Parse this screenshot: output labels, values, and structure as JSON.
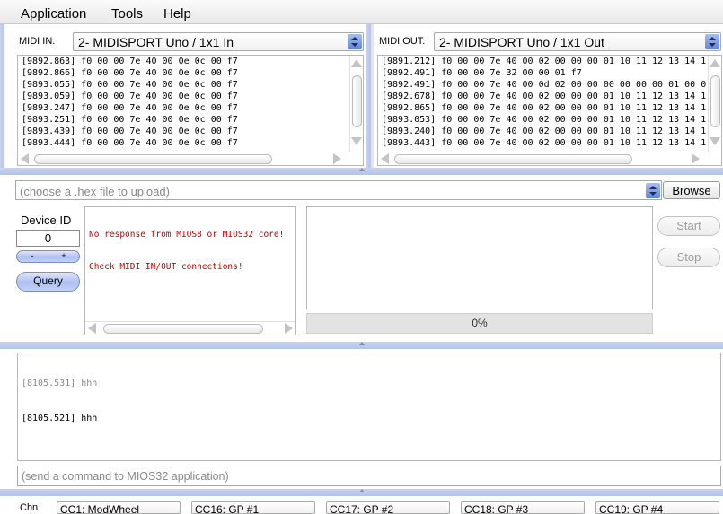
{
  "menubar": {
    "items": [
      "Application",
      "Tools",
      "Help"
    ]
  },
  "midi_in": {
    "label": "MIDI IN:",
    "selected": "2- MIDISPORT Uno / 1x1 In",
    "log": [
      "[9892.863] f0 00 00 7e 40 00 0e 0c 00 f7",
      "[9892.866] f0 00 00 7e 40 00 0e 0c 00 f7",
      "[9893.055] f0 00 00 7e 40 00 0e 0c 00 f7",
      "[9893.059] f0 00 00 7e 40 00 0e 0c 00 f7",
      "[9893.247] f0 00 00 7e 40 00 0e 0c 00 f7",
      "[9893.251] f0 00 00 7e 40 00 0e 0c 00 f7",
      "[9893.439] f0 00 00 7e 40 00 0e 0c 00 f7",
      "[9893.444] f0 00 00 7e 40 00 0e 0c 00 f7"
    ]
  },
  "midi_out": {
    "label": "MIDI OUT:",
    "selected": "2- MIDISPORT Uno / 1x1 Out",
    "log": [
      "[9891.212] f0 00 00 7e 40 00 02 00 00 00 01 10 11 12 13 14 1",
      "[9892.491] f0 00 00 7e 32 00 00 01 f7",
      "[9892.491] f0 00 00 7e 40 00 0d 02 00 00 00 00 00 00 01 00 0",
      "[9892.678] f0 00 00 7e 40 00 02 00 00 00 01 10 11 12 13 14 1",
      "[9892.865] f0 00 00 7e 40 00 02 00 00 00 01 10 11 12 13 14 1",
      "[9893.053] f0 00 00 7e 40 00 02 00 00 00 01 10 11 12 13 14 1",
      "[9893.240] f0 00 00 7e 40 00 02 00 00 00 01 10 11 12 13 14 1",
      "[9893.443] f0 00 00 7e 40 00 02 00 00 00 01 10 11 12 13 14 1"
    ]
  },
  "upload": {
    "file_placeholder": "(choose a .hex file to upload)",
    "browse_label": "Browse",
    "device_id_label": "Device ID",
    "device_id_value": "0",
    "minus_label": "-",
    "plus_label": "+",
    "query_label": "Query",
    "status_messages": [
      "No response from MIOS8 or MIOS32 core!",
      "Check MIDI IN/OUT connections!"
    ],
    "progress": "0%",
    "start_label": "Start",
    "stop_label": "Stop"
  },
  "terminal": {
    "lines": [
      "[8105.531] hhh",
      "[8105.521] hhh"
    ],
    "command_placeholder": "(send a command to MIOS32 application)"
  },
  "controls": {
    "chn_label": "Chn",
    "selects": [
      "CC1: ModWheel",
      "CC16: GP #1",
      "CC17: GP #2",
      "CC18: GP #3",
      "CC19: GP #4"
    ]
  },
  "colors": {
    "status_error": "#cc0000",
    "splitter": "#b8c6ec",
    "select_arrow": "#5c86dc"
  }
}
